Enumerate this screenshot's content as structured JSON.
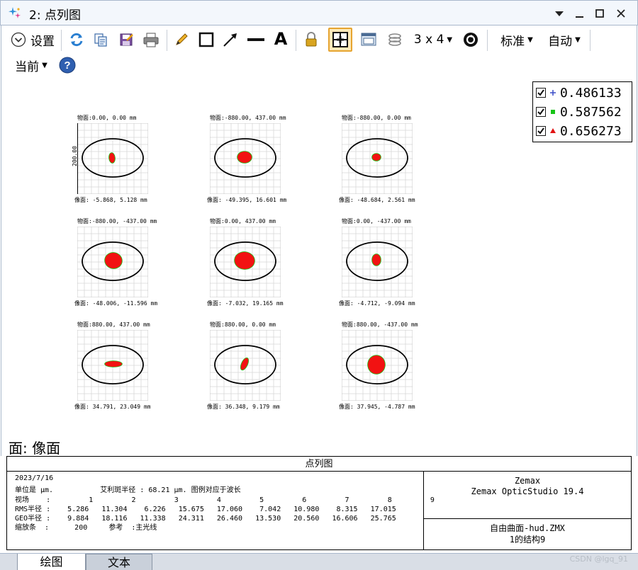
{
  "window": {
    "title": "2: 点列图"
  },
  "toolbar": {
    "settings_label": "设置",
    "layout_label": "3 x 4",
    "standard_label": "标准",
    "auto_label": "自动",
    "current_label": "当前",
    "text_tool_label": "A"
  },
  "legend": [
    {
      "value": "0.486133",
      "color": "#3a4cc7",
      "marker": "plus"
    },
    {
      "value": "0.587562",
      "color": "#17c417",
      "marker": "square"
    },
    {
      "value": "0.656273",
      "color": "#e11313",
      "marker": "triangle"
    }
  ],
  "spots": [
    {
      "field": "物面:0.00, 0.00 mm",
      "image": "像面: -5.868, 5.128 mm",
      "scale_label": "200.00"
    },
    {
      "field": "物面:-880.00, 437.00 mm",
      "image": "像面: -49.395, 16.601 mm"
    },
    {
      "field": "物面:-880.00, 0.00 mm",
      "image": "像面: -48.684, 2.561 mm"
    },
    {
      "field": "物面:-880.00, -437.00 mm",
      "image": "像面: -48.006, -11.596 mm"
    },
    {
      "field": "物面:0.00, 437.00 mm",
      "image": "像面: -7.032, 19.165 mm"
    },
    {
      "field": "物面:0.00, -437.00 mm",
      "image": "像面: -4.712, -9.094 mm"
    },
    {
      "field": "物面:880.00, 437.00 mm",
      "image": "像面: 34.791, 23.049 mm"
    },
    {
      "field": "物面:880.00, 0.00 mm",
      "image": "像面: 36.348, 9.179 mm"
    },
    {
      "field": "物面:880.00, -437.00 mm",
      "image": "像面: 37.945, -4.787 mm"
    }
  ],
  "surface_label": "面: 像面",
  "info": {
    "header": "点列图",
    "date": "2023/7/16",
    "units_line": "单位是 μm.           艾利斑半径 : 68.21 μm. 图例对应于波长",
    "field_line": "视场    :         1         2         3         4         5         6         7         8         9",
    "rms_line": "RMS半径 :    5.286   11.304    6.226   15.675   17.060    7.042   10.980    8.315   17.015",
    "geo_line": "GEO半径 :    9.884   18.116   11.338   24.311   26.460   13.530   20.560   16.606   25.765",
    "scale_line": "缩放条  :      200     参考  :主光线",
    "company": "Zemax",
    "product": "Zemax OpticStudio 19.4",
    "file": "自由曲面-hud.ZMX",
    "config": "1的结构9"
  },
  "tabs": {
    "plot": "绘图",
    "text": "文本"
  },
  "watermark": "CSDN @lgq_91"
}
